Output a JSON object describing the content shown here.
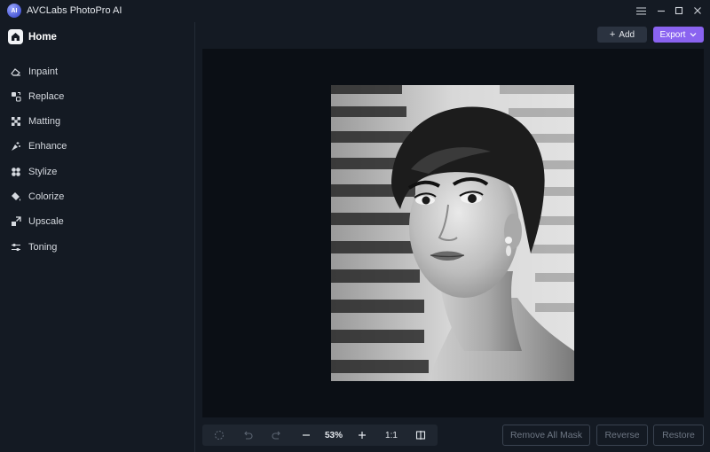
{
  "titlebar": {
    "logo_text": "AI",
    "title": "AVCLabs PhotoPro AI",
    "icons": [
      "menu-icon",
      "minimize-icon",
      "maximize-icon",
      "close-icon"
    ]
  },
  "sidebar": {
    "home_label": "Home",
    "items": [
      {
        "label": "Inpaint",
        "icon": "eraser-icon"
      },
      {
        "label": "Replace",
        "icon": "replace-icon"
      },
      {
        "label": "Matting",
        "icon": "matting-icon"
      },
      {
        "label": "Enhance",
        "icon": "enhance-icon"
      },
      {
        "label": "Stylize",
        "icon": "stylize-icon"
      },
      {
        "label": "Colorize",
        "icon": "paint-bucket-icon"
      },
      {
        "label": "Upscale",
        "icon": "upscale-icon"
      },
      {
        "label": "Toning",
        "icon": "sliders-icon"
      }
    ]
  },
  "toolbar": {
    "add_label": "Add",
    "export_label": "Export"
  },
  "zoom": {
    "level": "53%",
    "one_to_one": "1:1"
  },
  "actions": {
    "remove_all_mask": "Remove All Mask",
    "reverse": "Reverse",
    "restore": "Restore"
  },
  "colors": {
    "background": "#141a23",
    "canvas": "#0b0f15",
    "accent": "#8a63f0"
  }
}
